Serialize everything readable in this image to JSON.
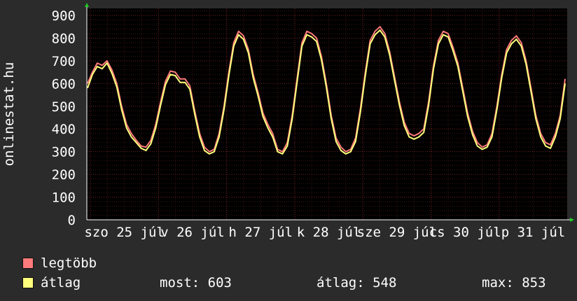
{
  "chart_data": {
    "type": "line",
    "ylabel": "onlinestat.hu",
    "ylim": [
      0,
      900
    ],
    "yticks": [
      0,
      100,
      200,
      300,
      400,
      500,
      600,
      700,
      800,
      900
    ],
    "grid": true,
    "x_tick_labels": [
      "szo 25 júl",
      "v 26 júl",
      "h 27 júl",
      "k 28 júl",
      "sze 29 júl",
      "cs 30 júl",
      "p 31 júl"
    ],
    "series": [
      {
        "name": "legtöbb",
        "color": "#ff7b7b",
        "values": [
          600,
          650,
          690,
          680,
          700,
          660,
          600,
          500,
          420,
          380,
          350,
          325,
          320,
          350,
          420,
          520,
          610,
          655,
          650,
          620,
          620,
          590,
          480,
          380,
          320,
          300,
          310,
          380,
          500,
          650,
          780,
          830,
          810,
          750,
          640,
          560,
          470,
          420,
          380,
          310,
          300,
          340,
          460,
          620,
          780,
          830,
          820,
          800,
          720,
          600,
          460,
          360,
          320,
          300,
          310,
          360,
          490,
          650,
          790,
          830,
          850,
          820,
          740,
          630,
          520,
          430,
          380,
          370,
          380,
          400,
          520,
          680,
          790,
          830,
          820,
          760,
          690,
          580,
          470,
          390,
          340,
          320,
          330,
          380,
          500,
          640,
          750,
          790,
          810,
          780,
          700,
          580,
          460,
          380,
          340,
          330,
          380,
          460,
          620
        ]
      },
      {
        "name": "átlag",
        "color": "#ffff7b",
        "values": [
          580,
          640,
          675,
          665,
          690,
          645,
          585,
          485,
          405,
          365,
          340,
          315,
          305,
          335,
          405,
          505,
          595,
          640,
          635,
          605,
          605,
          575,
          465,
          365,
          305,
          290,
          300,
          365,
          485,
          635,
          765,
          815,
          795,
          735,
          625,
          545,
          455,
          405,
          365,
          300,
          290,
          325,
          445,
          605,
          765,
          815,
          805,
          785,
          705,
          585,
          445,
          345,
          305,
          290,
          300,
          345,
          475,
          635,
          775,
          815,
          835,
          805,
          725,
          615,
          505,
          415,
          365,
          355,
          365,
          385,
          505,
          665,
          775,
          815,
          805,
          745,
          675,
          565,
          455,
          375,
          325,
          310,
          320,
          365,
          485,
          625,
          735,
          775,
          795,
          765,
          685,
          565,
          445,
          365,
          325,
          315,
          365,
          445,
          600
        ]
      }
    ]
  },
  "legend": {
    "max_label": "legtöbb",
    "avg_label": "átlag",
    "now_label": "most:",
    "now_value": "603",
    "avg_stat_label": "átlag:",
    "avg_stat_value": "548",
    "max_stat_label": "max:",
    "max_stat_value": "853"
  }
}
